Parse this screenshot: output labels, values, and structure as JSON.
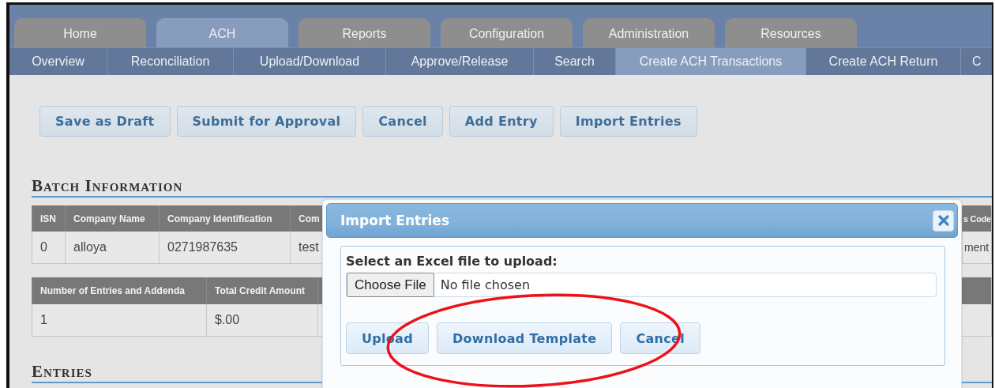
{
  "tabs": [
    {
      "label": "Home",
      "selected": false
    },
    {
      "label": "ACH",
      "selected": true
    },
    {
      "label": "Reports",
      "selected": false
    },
    {
      "label": "Configuration",
      "selected": false
    },
    {
      "label": "Administration",
      "selected": false
    },
    {
      "label": "Resources",
      "selected": false
    }
  ],
  "subnav": [
    {
      "label": "Overview",
      "selected": false
    },
    {
      "label": "Reconciliation",
      "selected": false
    },
    {
      "label": "Upload/Download",
      "selected": false
    },
    {
      "label": "Approve/Release",
      "selected": false
    },
    {
      "label": "Search",
      "selected": false
    },
    {
      "label": "Create ACH Transactions",
      "selected": true
    },
    {
      "label": "Create ACH Return",
      "selected": false
    },
    {
      "label": "C",
      "selected": false
    }
  ],
  "actions": [
    "Save as Draft",
    "Submit for Approval",
    "Cancel",
    "Add Entry",
    "Import Entries"
  ],
  "batch_section": {
    "title": "Batch Information",
    "table": {
      "columns": [
        "ISN",
        "Company Name",
        "Company Identification",
        "Com",
        "s Code"
      ],
      "rows": [
        [
          "0",
          "alloya",
          "0271987635",
          "test",
          "ment"
        ]
      ]
    },
    "totals_table": {
      "columns": [
        "Number of Entries and Addenda",
        "Total Credit Amount"
      ],
      "rows": [
        [
          "1",
          "$.00"
        ]
      ]
    }
  },
  "entries_section": {
    "title": "Entries"
  },
  "dialog": {
    "title": "Import Entries",
    "prompt": "Select an Excel file to upload:",
    "choose_button": "Choose File",
    "file_status": "No file chosen",
    "buttons": [
      "Upload",
      "Download Template",
      "Cancel"
    ]
  },
  "annotation": {
    "kind": "ellipse"
  }
}
